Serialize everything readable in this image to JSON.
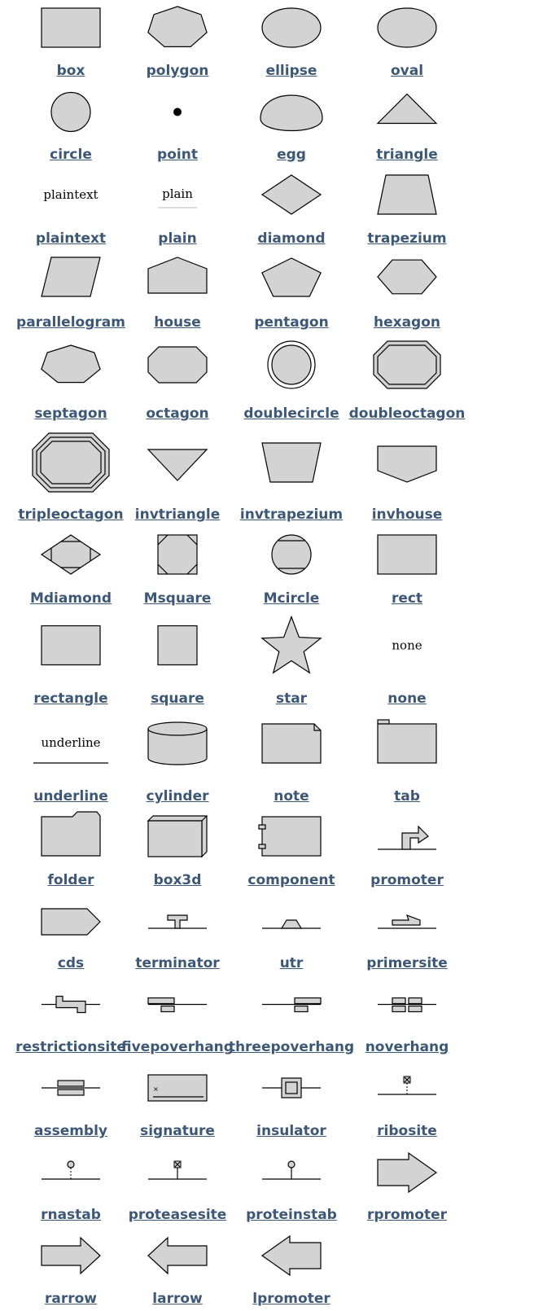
{
  "shapes": [
    {
      "id": "box",
      "label": "box"
    },
    {
      "id": "polygon",
      "label": "polygon"
    },
    {
      "id": "ellipse",
      "label": "ellipse"
    },
    {
      "id": "oval",
      "label": "oval"
    },
    {
      "id": "circle",
      "label": "circle"
    },
    {
      "id": "point",
      "label": "point"
    },
    {
      "id": "egg",
      "label": "egg"
    },
    {
      "id": "triangle",
      "label": "triangle"
    },
    {
      "id": "plaintext",
      "label": "plaintext",
      "inner_text": "plaintext"
    },
    {
      "id": "plain",
      "label": "plain",
      "inner_text": "plain"
    },
    {
      "id": "diamond",
      "label": "diamond"
    },
    {
      "id": "trapezium",
      "label": "trapezium"
    },
    {
      "id": "parallelogram",
      "label": "parallelogram"
    },
    {
      "id": "house",
      "label": "house"
    },
    {
      "id": "pentagon",
      "label": "pentagon"
    },
    {
      "id": "hexagon",
      "label": "hexagon"
    },
    {
      "id": "septagon",
      "label": "septagon"
    },
    {
      "id": "octagon",
      "label": "octagon"
    },
    {
      "id": "doublecircle",
      "label": "doublecircle"
    },
    {
      "id": "doubleoctagon",
      "label": "doubleoctagon"
    },
    {
      "id": "tripleoctagon",
      "label": "tripleoctagon"
    },
    {
      "id": "invtriangle",
      "label": "invtriangle"
    },
    {
      "id": "invtrapezium",
      "label": "invtrapezium"
    },
    {
      "id": "invhouse",
      "label": "invhouse"
    },
    {
      "id": "Mdiamond",
      "label": "Mdiamond"
    },
    {
      "id": "Msquare",
      "label": "Msquare"
    },
    {
      "id": "Mcircle",
      "label": "Mcircle"
    },
    {
      "id": "rect",
      "label": "rect"
    },
    {
      "id": "rectangle",
      "label": "rectangle"
    },
    {
      "id": "square",
      "label": "square"
    },
    {
      "id": "star",
      "label": "star"
    },
    {
      "id": "none",
      "label": "none",
      "inner_text": "none"
    },
    {
      "id": "underline",
      "label": "underline",
      "inner_text": "underline"
    },
    {
      "id": "cylinder",
      "label": "cylinder"
    },
    {
      "id": "note",
      "label": "note"
    },
    {
      "id": "tab",
      "label": "tab"
    },
    {
      "id": "folder",
      "label": "folder"
    },
    {
      "id": "box3d",
      "label": "box3d"
    },
    {
      "id": "component",
      "label": "component"
    },
    {
      "id": "promoter",
      "label": "promoter"
    },
    {
      "id": "cds",
      "label": "cds"
    },
    {
      "id": "terminator",
      "label": "terminator"
    },
    {
      "id": "utr",
      "label": "utr"
    },
    {
      "id": "primersite",
      "label": "primersite"
    },
    {
      "id": "restrictionsite",
      "label": "restrictionsite"
    },
    {
      "id": "fivepoverhang",
      "label": "fivepoverhang"
    },
    {
      "id": "threepoverhang",
      "label": "threepoverhang"
    },
    {
      "id": "noverhang",
      "label": "noverhang"
    },
    {
      "id": "assembly",
      "label": "assembly"
    },
    {
      "id": "signature",
      "label": "signature"
    },
    {
      "id": "insulator",
      "label": "insulator"
    },
    {
      "id": "ribosite",
      "label": "ribosite"
    },
    {
      "id": "rnastab",
      "label": "rnastab"
    },
    {
      "id": "proteasesite",
      "label": "proteasesite"
    },
    {
      "id": "proteinstab",
      "label": "proteinstab"
    },
    {
      "id": "rpromoter",
      "label": "rpromoter"
    },
    {
      "id": "rarrow",
      "label": "rarrow"
    },
    {
      "id": "larrow",
      "label": "larrow"
    },
    {
      "id": "lpromoter",
      "label": "lpromoter"
    }
  ],
  "colors": {
    "fill": "#d3d3d3",
    "stroke": "#000000",
    "label": "#3d5877",
    "tile_background": "#f7f9f7"
  }
}
